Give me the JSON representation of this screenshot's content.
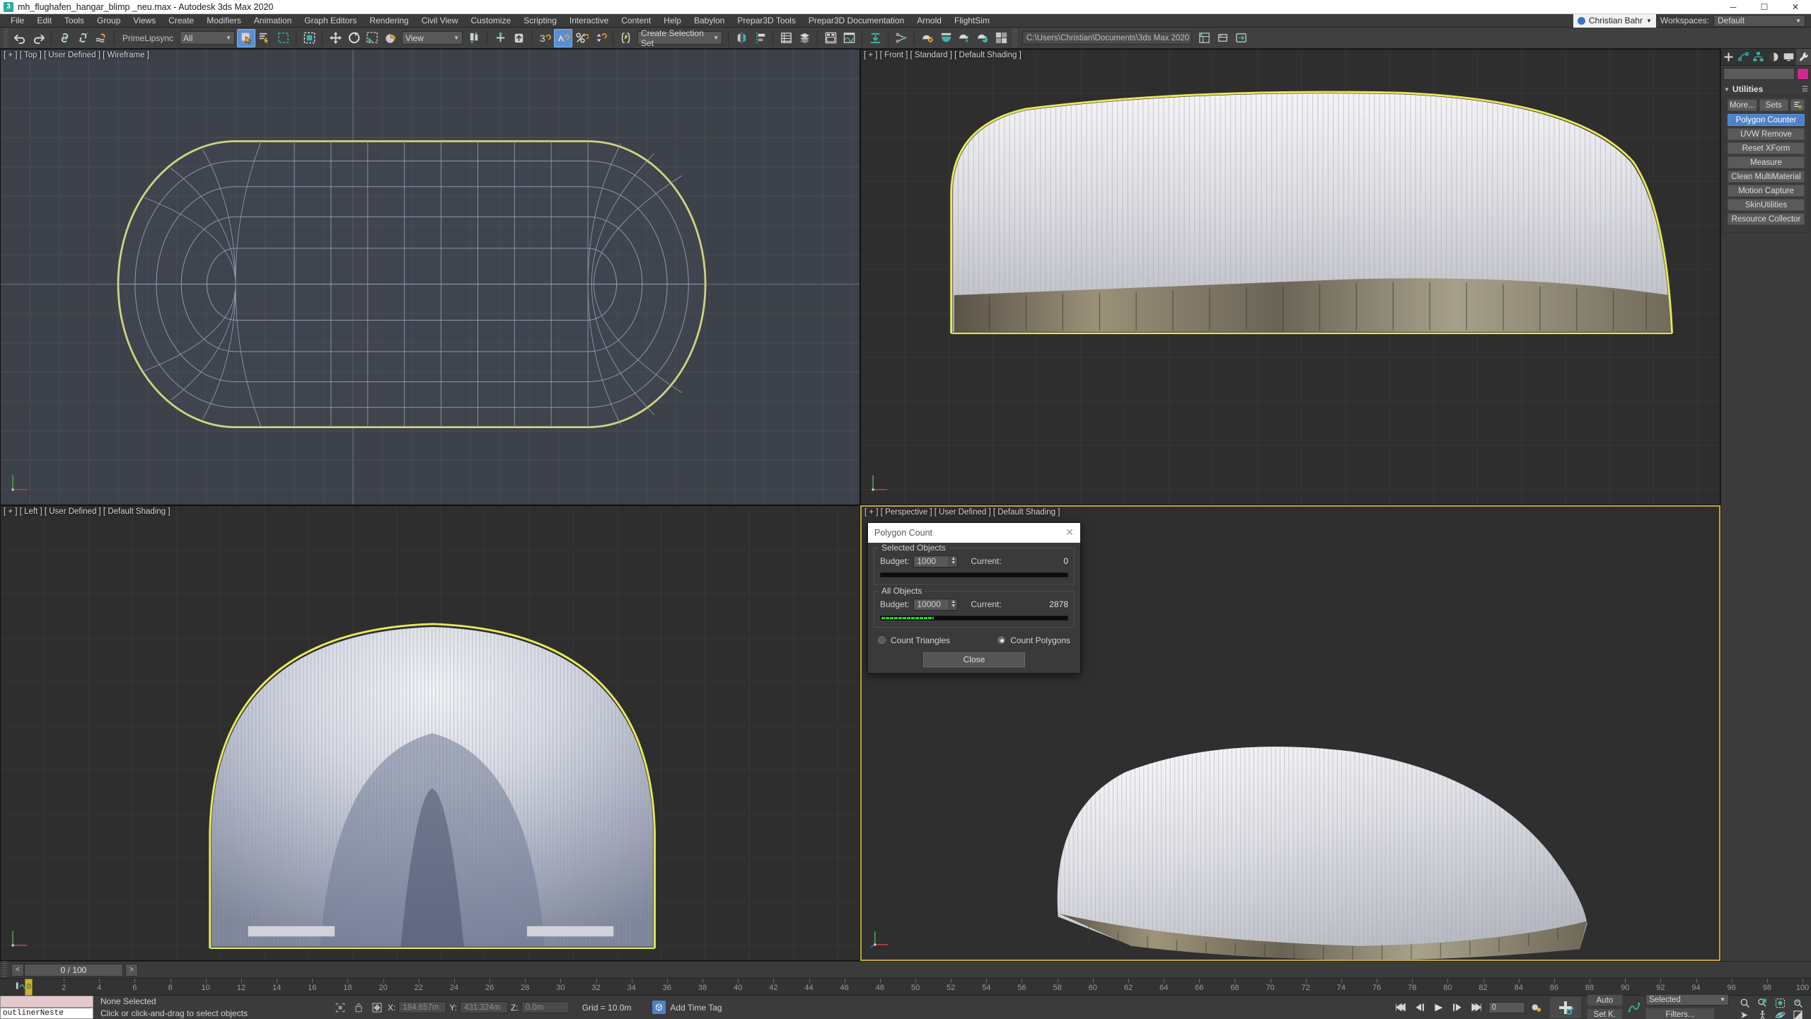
{
  "titlebar": {
    "icon": "max-logo-icon",
    "text": "mh_flughafen_hangar_blimp _neu.max - Autodesk 3ds Max 2020",
    "minimize": "─",
    "maximize": "☐",
    "close": "✕"
  },
  "menubar": {
    "items": [
      "File",
      "Edit",
      "Tools",
      "Group",
      "Views",
      "Create",
      "Modifiers",
      "Animation",
      "Graph Editors",
      "Rendering",
      "Civil View",
      "Customize",
      "Scripting",
      "Interactive",
      "Content",
      "Help",
      "Babylon",
      "Prepar3D Tools",
      "Prepar3D Documentation",
      "Arnold",
      "FlightSim"
    ],
    "user": "Christian Bahr",
    "workspaces_label": "Workspaces:",
    "workspace_value": "Default"
  },
  "toolbar": {
    "undo": "undo-icon",
    "redo": "redo-icon",
    "select_link": "select-and-link-icon",
    "unlink": "unlink-selection-icon",
    "bind_space_warp": "bind-to-space-warp-icon",
    "primelipsync_label": "PrimeLipsync",
    "filter_value": "All",
    "select_object": "select-object-icon",
    "select_by_name": "select-by-name-icon",
    "select_region": "select-region-icon",
    "window_crossing": "window-crossing-icon",
    "select_move": "select-and-move-icon",
    "select_rotate": "select-and-rotate-icon",
    "select_scale": "select-and-scale-icon",
    "placement": "placement-icon",
    "ref_coord_value": "View",
    "pivot": "use-pivot-point-center-icon",
    "snap_toggle": "snaps-toggle-icon",
    "angle_snap": "angle-snap-toggle-icon",
    "percent_snap": "percent-snap-toggle-icon",
    "spinner_snap": "spinner-snap-toggle-icon",
    "named_sets_icon": "edit-named-selection-sets-icon",
    "selection_set_value": "Create Selection Set",
    "mirror": "mirror-icon",
    "align": "align-icon",
    "layer_explorer": "layer-explorer-icon",
    "scene_explorer": "scene-explorer-icon",
    "curve_editor": "curve-editor-icon",
    "schematic_view": "schematic-view-icon",
    "project_folder": "C:\\Users\\Christian\\Documents\\3ds Max 2020",
    "render_setup": "render-setup-icon",
    "render_frame": "rendered-frame-window-icon",
    "render_production": "render-production-icon",
    "render_iterative": "render-iterative-icon",
    "material_editor": "material-editor-icon",
    "asset_tracking": "asset-tracking-icon"
  },
  "viewports": [
    {
      "label": "[ + ] [ Top ] [ User Defined ] [ Wireframe ]",
      "name": "viewport-top"
    },
    {
      "label": "[ + ] [ Front ] [ Standard ] [ Default Shading ]",
      "name": "viewport-front"
    },
    {
      "label": "[ + ] [ Left ] [ User Defined ] [ Default Shading ]",
      "name": "viewport-left"
    },
    {
      "label": "[ + ] [ Perspective ] [ User Defined ] [ Default Shading ]",
      "name": "viewport-perspective"
    }
  ],
  "command_panel": {
    "tabs": [
      "create-tab",
      "modify-tab",
      "hierarchy-tab",
      "motion-tab",
      "display-tab",
      "utilities-tab"
    ],
    "selected_tab": "utilities-tab",
    "object_name": "",
    "object_color": "#d2268e",
    "rollout_title": "Utilities",
    "buttons_top": [
      "More...",
      "Sets"
    ],
    "config_icon": "configure-button-sets-icon",
    "utility_buttons": [
      {
        "label": "Polygon Counter",
        "active": true
      },
      {
        "label": "UVW Remove",
        "active": false
      },
      {
        "label": "Reset XForm",
        "active": false
      },
      {
        "label": "Measure",
        "active": false
      },
      {
        "label": "Clean MultiMaterial",
        "active": false
      },
      {
        "label": "Motion Capture",
        "active": false
      },
      {
        "label": "SkinUtilities",
        "active": false
      },
      {
        "label": "Resource Collector",
        "active": false
      }
    ]
  },
  "polygon_count_dialog": {
    "title": "Polygon Count",
    "close_icon": "close-icon",
    "selected_group": {
      "title": "Selected Objects",
      "budget_label": "Budget:",
      "budget_value": "1000",
      "current_label": "Current:",
      "current_value": "0",
      "bar_percent": 0.5
    },
    "all_group": {
      "title": "All Objects",
      "budget_label": "Budget:",
      "budget_value": "10000",
      "current_label": "Current:",
      "current_value": "2878",
      "bar_percent": 28.78
    },
    "count_triangles_label": "Count Triangles",
    "count_polygons_label": "Count Polygons",
    "selected_mode": "Count Polygons",
    "close_button": "Close"
  },
  "timeslider": {
    "prev_label": "<",
    "frame_label": "0 / 100",
    "next_label": ">",
    "ticks": [
      0,
      2,
      4,
      6,
      8,
      10,
      12,
      14,
      16,
      18,
      20,
      22,
      24,
      26,
      28,
      30,
      32,
      34,
      36,
      38,
      40,
      42,
      44,
      46,
      48,
      50,
      52,
      54,
      56,
      58,
      60,
      62,
      64,
      66,
      68,
      70,
      72,
      74,
      76,
      78,
      80,
      82,
      84,
      86,
      88,
      90,
      92,
      94,
      96,
      98,
      100
    ],
    "playhead_frame": 0,
    "track_icon": "track-view-icon"
  },
  "statusbar": {
    "maxscript_listener_text": "outlinerNeste",
    "selection_status": "None Selected",
    "prompt": "Click or click-and-drag to select objects",
    "isolate_icon": "isolate-selection-icon",
    "lock_icon": "selection-lock-icon",
    "transform_icon": "absolute-relative-transform-icon",
    "coords": [
      {
        "axis": "X:",
        "value": "184.657m"
      },
      {
        "axis": "Y:",
        "value": "431.324m"
      },
      {
        "axis": "Z:",
        "value": "0.0m"
      }
    ],
    "grid_text": "Grid = 10.0m",
    "add_time_tag": "Add Time Tag",
    "time_tag_icon": "time-tag-icon",
    "playback": {
      "goto_start": "goto-start-icon",
      "prev_frame": "previous-frame-icon",
      "play": "play-animation-icon",
      "next_frame": "next-frame-icon",
      "goto_end": "goto-end-icon",
      "current_frame": "0",
      "key_mode": "key-mode-toggle-icon"
    },
    "auto_key": "Auto",
    "set_key": "Set K.",
    "key_filters": "Filters...",
    "selection_level": "Selected",
    "add_key_icon": "add-time-tag-key-icon",
    "param_curve_icon": "parameter-curve-icon",
    "nav_icons": [
      "zoom-icon",
      "zoom-all-icon",
      "zoom-extents-icon",
      "zoom-region-icon",
      "pan-icon",
      "walkthrough-icon",
      "orbit-icon",
      "maximize-viewport-icon"
    ]
  }
}
